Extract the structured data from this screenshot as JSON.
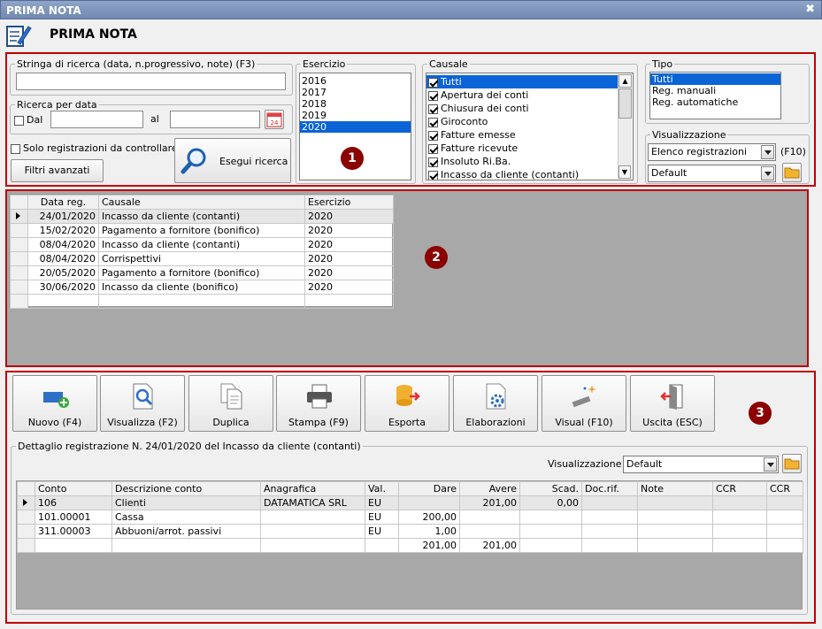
{
  "window": {
    "title": "PRIMA NOTA",
    "heading": "PRIMA NOTA",
    "close_glyph": "✖"
  },
  "search": {
    "text_legend": "Stringa di ricerca (data, n.progressivo, note) (F3)",
    "text_value": "",
    "date_legend": "Ricerca per data",
    "from_label": "Dal",
    "from_value": "",
    "to_label": "al",
    "to_value": "",
    "calendar_icon": "calendar-icon",
    "calendar_text": "24",
    "only_check_label": "Solo registrazioni da controllare",
    "advanced_button": "Filtri avanzati",
    "run_button": "Esegui ricerca"
  },
  "esercizio": {
    "legend": "Esercizio",
    "items": [
      "2016",
      "2017",
      "2018",
      "2019",
      "2020"
    ],
    "selected": "2020"
  },
  "causale": {
    "legend": "Causale",
    "items": [
      "Tutti",
      "Apertura dei conti",
      "Chiusura dei conti",
      "Giroconto",
      "Fatture emesse",
      "Fatture ricevute",
      "Insoluto Ri.Ba.",
      "Incasso da cliente (contanti)"
    ],
    "selected": "Tutti"
  },
  "tipo": {
    "legend": "Tipo",
    "items": [
      "Tutti",
      "Reg. manuali",
      "Reg. automatiche"
    ],
    "selected": "Tutti"
  },
  "visualizzazione": {
    "legend": "Visualizzazione",
    "view_value": "Elenco registrazioni",
    "view_shortcut": "(F10)",
    "layout_value": "Default"
  },
  "badges": {
    "one": "1",
    "two": "2",
    "three": "3"
  },
  "registrations": {
    "columns": [
      "Data reg.",
      "Causale",
      "Esercizio"
    ],
    "rows": [
      [
        "24/01/2020",
        "Incasso da cliente (contanti)",
        "2020"
      ],
      [
        "15/02/2020",
        "Pagamento a fornitore (bonifico)",
        "2020"
      ],
      [
        "08/04/2020",
        "Incasso da cliente (contanti)",
        "2020"
      ],
      [
        "08/04/2020",
        "Corrispettivi",
        "2020"
      ],
      [
        "20/05/2020",
        "Pagamento a fornitore (bonifico)",
        "2020"
      ],
      [
        "30/06/2020",
        "Incasso da cliente (bonifico)",
        "2020"
      ]
    ]
  },
  "toolbar": {
    "buttons": [
      {
        "label": "Nuovo (F4)",
        "icon": "new-record-icon"
      },
      {
        "label": "Visualizza (F2)",
        "icon": "view-document-icon"
      },
      {
        "label": "Duplica",
        "icon": "duplicate-icon"
      },
      {
        "label": "Stampa (F9)",
        "icon": "printer-icon"
      },
      {
        "label": "Esporta",
        "icon": "export-icon"
      },
      {
        "label": "Elaborazioni",
        "icon": "processing-gear-icon"
      },
      {
        "label": "Visual (F10)",
        "icon": "magic-wand-icon"
      },
      {
        "label": "Uscita (ESC)",
        "icon": "exit-door-icon"
      }
    ]
  },
  "detail": {
    "legend": "Dettaglio registrazione N. 24/01/2020 del Incasso da cliente (contanti)",
    "view_label": "Visualizzazione :",
    "view_value": "Default",
    "columns": [
      "Conto",
      "Descrizione conto",
      "Anagrafica",
      "Val.",
      "Dare",
      "Avere",
      "Scad.",
      "Doc.rif.",
      "Note",
      "CCR",
      "CCR"
    ],
    "rows": [
      [
        "106",
        "Clienti",
        "DATAMATICA SRL",
        "EU",
        "",
        "201,00",
        "0,00",
        "",
        "",
        "",
        ""
      ],
      [
        "101.00001",
        "Cassa",
        "",
        "EU",
        "200,00",
        "",
        "",
        "",
        "",
        "",
        ""
      ],
      [
        "311.00003",
        "Abbuoni/arrot. passivi",
        "",
        "EU",
        "1,00",
        "",
        "",
        "",
        "",
        "",
        ""
      ]
    ],
    "totals": {
      "dare": "201,00",
      "avere": "201,00"
    }
  }
}
